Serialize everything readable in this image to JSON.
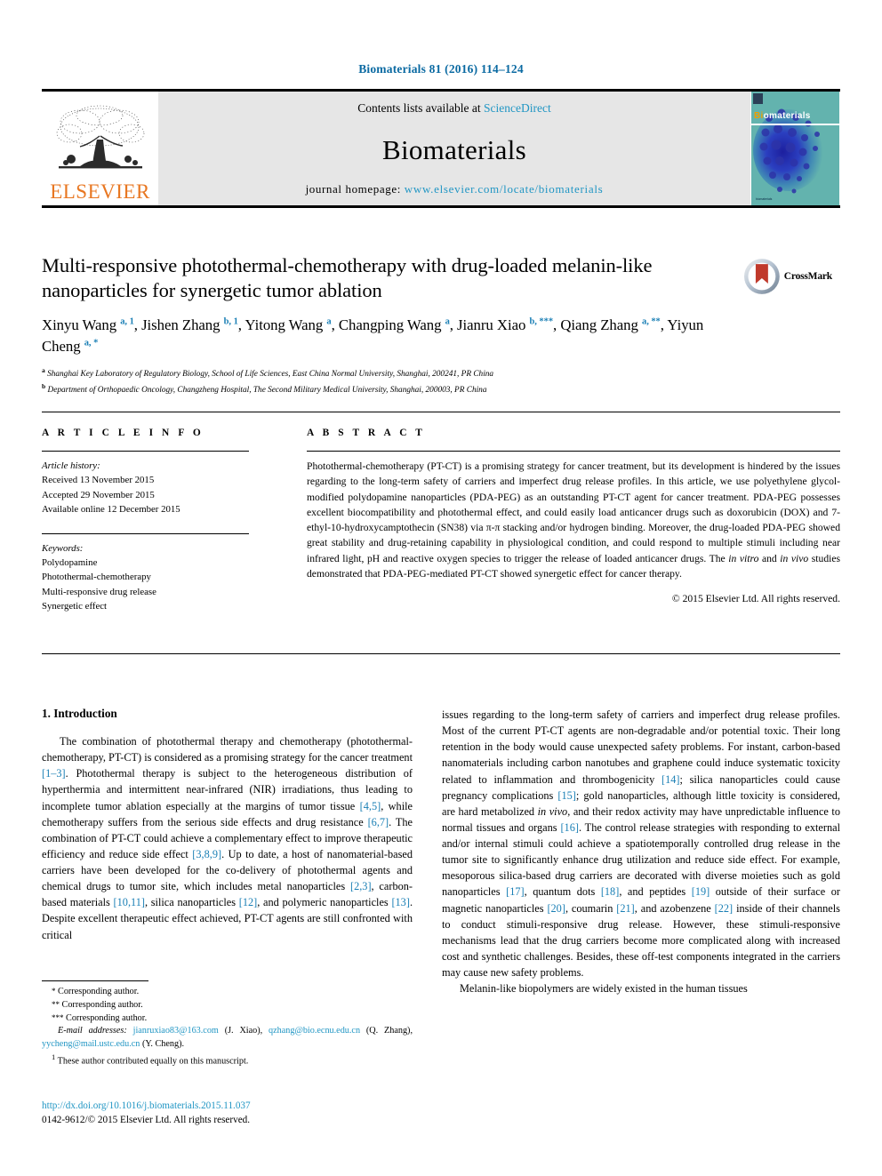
{
  "running_head": "Biomaterials 81 (2016) 114–124",
  "masthead": {
    "publisher_name": "ELSEVIER",
    "contents_prefix": "Contents lists available at ",
    "contents_link": "ScienceDirect",
    "journal_name": "Biomaterials",
    "homepage_prefix": "journal homepage: ",
    "homepage_url": "www.elsevier.com/locate/biomaterials",
    "cover_title_part1": "Bi",
    "cover_title_part2": "omaterials",
    "cover_footer": "biomaterials"
  },
  "crossmark": {
    "label": "CrossMark"
  },
  "article": {
    "title": "Multi-responsive photothermal-chemotherapy with drug-loaded melanin-like nanoparticles for synergetic tumor ablation",
    "authors_html": "Xinyu Wang <sup>a, 1</sup>, Jishen Zhang <sup>b, 1</sup>, Yitong Wang <sup>a</sup>, Changping Wang <sup>a</sup>, Jianru Xiao <sup>b, ***</sup>, Qiang Zhang <sup>a, **</sup>, Yiyun Cheng <sup>a, *</sup>",
    "affiliation_a": "Shanghai Key Laboratory of Regulatory Biology, School of Life Sciences, East China Normal University, Shanghai, 200241, PR China",
    "affiliation_b": "Department of Orthopaedic Oncology, Changzheng Hospital, The Second Military Medical University, Shanghai, 200003, PR China"
  },
  "article_info": {
    "heading": "A R T I C L E   I N F O",
    "history_label": "Article history:",
    "history": [
      "Received 13 November 2015",
      "Accepted 29 November 2015",
      "Available online 12 December 2015"
    ],
    "keywords_label": "Keywords:",
    "keywords": [
      "Polydopamine",
      "Photothermal-chemotherapy",
      "Multi-responsive drug release",
      "Synergetic effect"
    ]
  },
  "abstract": {
    "heading": "A B S T R A C T",
    "text_html": "Photothermal-chemotherapy (PT-CT) is a promising strategy for cancer treatment, but its development is hindered by the issues regarding to the long-term safety of carriers and imperfect drug release profiles. In this article, we use polyethylene glycol-modified polydopamine nanoparticles (PDA-PEG) as an outstanding PT-CT agent for cancer treatment. PDA-PEG possesses excellent biocompatibility and photothermal effect, and could easily load anticancer drugs such as doxorubicin (DOX) and 7-ethyl-10-hydroxycamptothecin (SN38) via π-π stacking and/or hydrogen binding. Moreover, the drug-loaded PDA-PEG showed great stability and drug-retaining capability in physiological condition, and could respond to multiple stimuli including near infrared light, pH and reactive oxygen species to trigger the release of loaded anticancer drugs. The <i>in vitro</i> and <i>in vivo</i> studies demonstrated that PDA-PEG-mediated PT-CT showed synergetic effect for cancer therapy.",
    "copyright": "© 2015 Elsevier Ltd. All rights reserved."
  },
  "body": {
    "section_heading": "1.  Introduction",
    "left_paragraph_html": "The combination of photothermal therapy and chemotherapy (photothermal-chemotherapy, PT-CT) is considered as a promising strategy for the cancer treatment <span class=\"ref\">[1–3]</span>. Photothermal therapy is subject to the heterogeneous distribution of hyperthermia and intermittent near-infrared (NIR) irradiations, thus leading to incomplete tumor ablation especially at the margins of tumor tissue <span class=\"ref\">[4,5]</span>, while chemotherapy suffers from the serious side effects and drug resistance <span class=\"ref\">[6,7]</span>. The combination of PT-CT could achieve a complementary effect to improve therapeutic efficiency and reduce side effect <span class=\"ref\">[3,8,9]</span>. Up to date, a host of nanomaterial-based carriers have been developed for the co-delivery of photothermal agents and chemical drugs to tumor site, which includes metal nanoparticles <span class=\"ref\">[2,3]</span>, carbon-based materials <span class=\"ref\">[10,11]</span>, silica nanoparticles <span class=\"ref\">[12]</span>, and polymeric nanoparticles <span class=\"ref\">[13]</span>. Despite excellent therapeutic effect achieved, PT-CT agents are still confronted with critical",
    "right_paragraph_html": "issues regarding to the long-term safety of carriers and imperfect drug release profiles. Most of the current PT-CT agents are non-degradable and/or potential toxic. Their long retention in the body would cause unexpected safety problems. For instant, carbon-based nanomaterials including carbon nanotubes and graphene could induce systematic toxicity related to inflammation and thrombogenicity <span class=\"ref\">[14]</span>; silica nanoparticles could cause pregnancy complications <span class=\"ref\">[15]</span>; gold nanoparticles, although little toxicity is considered, are hard metabolized <i class=\"it\">in vivo</i>, and their redox activity may have unpredictable influence to normal tissues and organs <span class=\"ref\">[16]</span>. The control release strategies with responding to external and/or internal stimuli could achieve a spatiotemporally controlled drug release in the tumor site to significantly enhance drug utilization and reduce side effect. For example, mesoporous silica-based drug carriers are decorated with diverse moieties such as gold nanoparticles <span class=\"ref\">[17]</span>, quantum dots <span class=\"ref\">[18]</span>, and peptides <span class=\"ref\">[19]</span> outside of their surface or magnetic nanoparticles <span class=\"ref\">[20]</span>, coumarin <span class=\"ref\">[21]</span>, and azobenzene <span class=\"ref\">[22]</span> inside of their channels to conduct stimuli-responsive drug release. However, these stimuli-responsive mechanisms lead that the drug carriers become more complicated along with increased cost and synthetic challenges. Besides, these off-test components integrated in the carriers may cause new safety problems.",
    "right_paragraph2_html": "Melanin-like biopolymers are widely existed in the human tissues"
  },
  "footnotes": {
    "corr1": "Corresponding author.",
    "corr2": "Corresponding author.",
    "corr3": "Corresponding author.",
    "emails_html": "<i>E-mail addresses:</i> <span class=\"link\">jianruxiao83@163.com</span> (J. Xiao), <span class=\"link\">qzhang@bio.ecnu.edu.cn</span> (Q. Zhang), <span class=\"link\">yycheng@mail.ustc.edu.cn</span> (Y. Cheng).",
    "equal_contrib": "These author contributed equally on this manuscript."
  },
  "footer": {
    "doi_url": "http://dx.doi.org/10.1016/j.biomaterials.2015.11.037",
    "issn_line": "0142-9612/© 2015 Elsevier Ltd. All rights reserved."
  },
  "colors": {
    "link_blue": "#2196c4",
    "ref_blue": "#1a7fb5",
    "elsevier_orange": "#E87722",
    "masthead_grey": "#e6e6e6"
  }
}
